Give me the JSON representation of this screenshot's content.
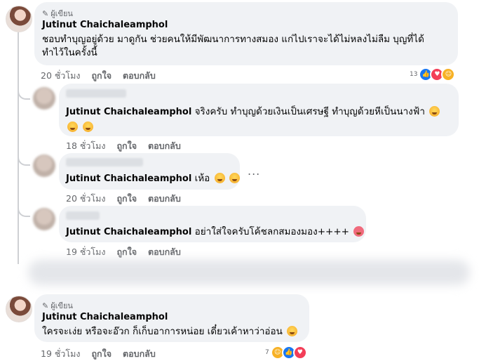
{
  "comments": [
    {
      "badge": "ผู้เขียน",
      "name": "Jutinut Chaichaleamphol",
      "text_line1": "ชอบทำบุญอยู่ด้วย มาดูกัน ช่วยคนให้มีพัฒนาการทางสมอง แก่ไปเราจะได้ไม่หลงไม่ลืม บุญที่ได้",
      "text_line2": "ทำไว้ในครั้งนี้",
      "time": "20 ชั่วโมง",
      "like": "ถูกใจ",
      "reply": "ตอบกลับ",
      "reaction_count": "13",
      "reactions": [
        "like-reaction",
        "love-reaction",
        "care-reaction"
      ]
    },
    {
      "name": "Jutinut Chaichaleamphol",
      "text_line1": "จริงครับ ทำบุญด้วยเงินเป็นเศรษฐี ทำบุญด้วยหีเป็นนางฟ้า",
      "time": "18 ชั่วโมง",
      "like": "ถูกใจ",
      "reply": "ตอบกลับ"
    },
    {
      "name": "Jutinut Chaichaleamphol",
      "text_line1": "เห้อ",
      "time": "20 ชั่วโมง",
      "like": "ถูกใจ",
      "reply": "ตอบกลับ",
      "more": "..."
    },
    {
      "name": "Jutinut Chaichaleamphol",
      "text_line1": "อย่าใส่ใจครับโค้ชลกสมองมอง++++",
      "time": "19 ชั่วโมง",
      "like": "ถูกใจ",
      "reply": "ตอบกลับ"
    },
    {
      "badge": "ผู้เขียน",
      "name": "Jutinut Chaichaleamphol",
      "text_line1": "ใครจะเง่ย หรือจะอ๊วก ก็เก็บอาการหน่อย เดี๋ยวเค้าหาว่าอ่อน",
      "time": "19 ชั่วโมง",
      "like": "ถูกใจ",
      "reply": "ตอบกลับ",
      "reaction_count": "7",
      "reactions": [
        "haha-reaction",
        "like-reaction",
        "love-reaction"
      ]
    }
  ],
  "colors": {
    "bubble": "#f0f2f5",
    "secondary_text": "#65676b",
    "like_blue": "#1877f2",
    "love_red": "#f33e58"
  }
}
